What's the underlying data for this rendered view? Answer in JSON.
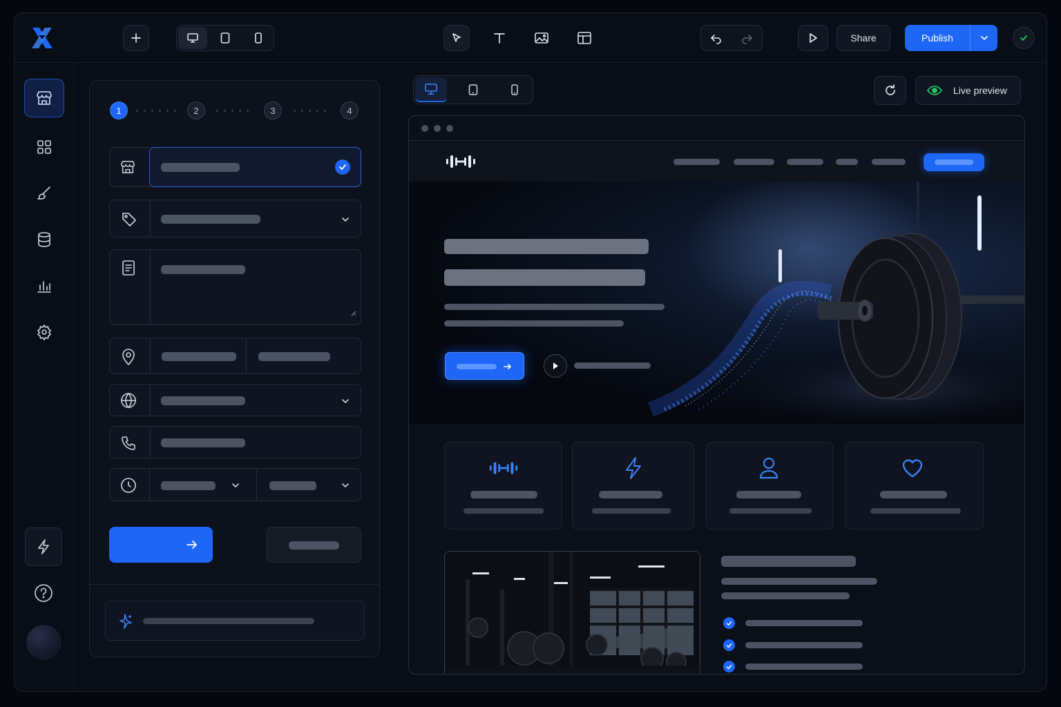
{
  "toolbar": {
    "share_label": "Share",
    "publish_label": "Publish"
  },
  "preview_bar": {
    "live_preview_label": "Live preview"
  },
  "wizard": {
    "steps": [
      "1",
      "2",
      "3",
      "4"
    ],
    "current_step": 1
  },
  "colors": {
    "accent": "#1e66f5",
    "background": "#090d16",
    "live_indicator": "#22c55e"
  },
  "icons": {
    "logo": "x-logo-icon",
    "add": "plus-icon",
    "devices": [
      "desktop-icon",
      "tablet-icon",
      "mobile-icon"
    ],
    "tools": [
      "cursor-icon",
      "text-icon",
      "image-icon",
      "layout-icon"
    ],
    "rail": [
      "store-icon",
      "grid-icon",
      "brush-icon",
      "database-icon",
      "chart-icon",
      "gear-icon",
      "lightning-icon",
      "help-icon"
    ],
    "fields": [
      "store-icon",
      "tag-icon",
      "document-icon",
      "location-pin-icon",
      "globe-icon",
      "phone-icon",
      "clock-icon"
    ],
    "features": [
      "dumbbell-icon",
      "lightning-icon",
      "user-icon",
      "heart-icon"
    ]
  }
}
